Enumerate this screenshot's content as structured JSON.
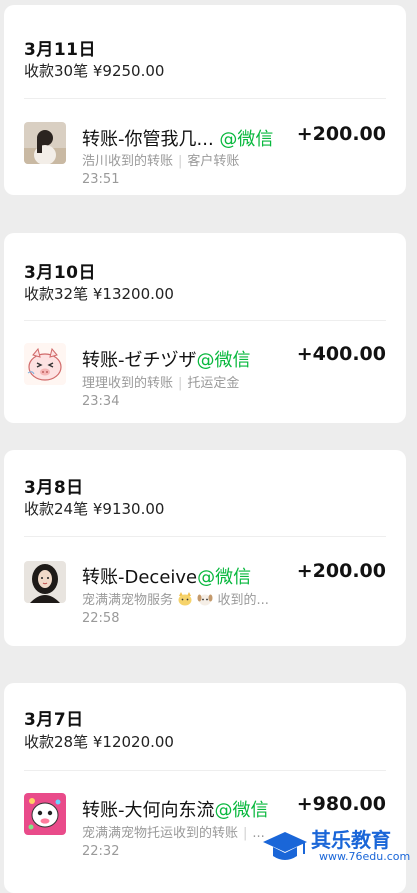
{
  "days": [
    {
      "date": "3月11日",
      "summary": "收款30笔 ¥9250.00",
      "tx": {
        "title": "转账-你管我几...",
        "via": "@微信",
        "sub_a": "浩川收到的转账",
        "sub_b": "客户转账",
        "time": "23:51",
        "amount": "+200.00",
        "avatar": "girl-photo-avatar"
      }
    },
    {
      "date": "3月10日",
      "summary": "收款32笔 ¥13200.00",
      "tx": {
        "title": "转账-ゼチヅザ",
        "via": "@微信",
        "sub_a": "理理收到的转账",
        "sub_b": "托运定金",
        "time": "23:34",
        "amount": "+400.00",
        "avatar": "cartoon-pig-avatar"
      }
    },
    {
      "date": "3月8日",
      "summary": "收款24笔 ¥9130.00",
      "tx": {
        "title": "转账-Deceive",
        "via": "@微信",
        "sub_a": "宠满满宠物服务",
        "sub_b": "收到的...",
        "time": "22:58",
        "amount": "+200.00",
        "avatar": "woman-photo-avatar"
      }
    },
    {
      "date": "3月7日",
      "summary": "收款28笔 ¥12020.00",
      "tx": {
        "title": "转账-大何向东流",
        "via": "@微信",
        "sub_a": "宠满满宠物托运收到的转账",
        "sub_b": "...",
        "time": "22:32",
        "amount": "+980.00",
        "avatar": "cartoon-character-avatar"
      }
    }
  ],
  "watermark": {
    "text": "其乐教育",
    "url": "www.76edu.com"
  },
  "colors": {
    "wechat_green": "#09b83e",
    "watermark_blue": "#1a66d8",
    "background": "#ededed"
  }
}
